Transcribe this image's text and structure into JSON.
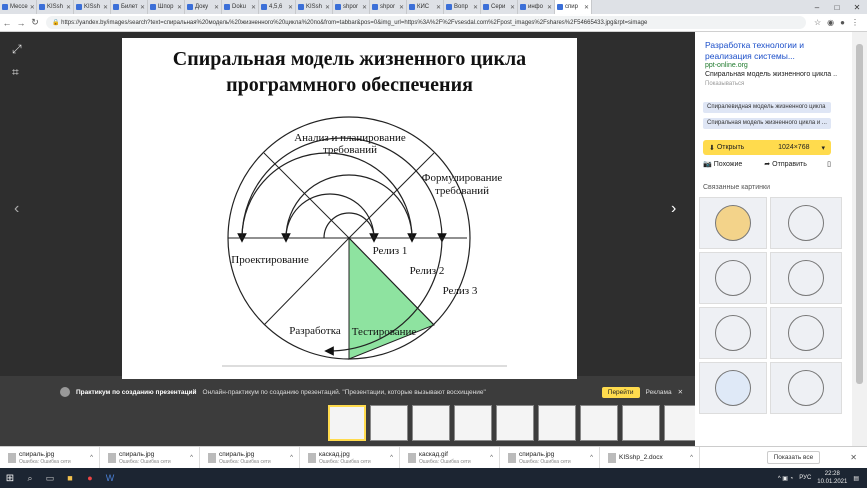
{
  "tabs": [
    {
      "label": "Мессе"
    },
    {
      "label": "KISsh"
    },
    {
      "label": "KISsh"
    },
    {
      "label": "Билет"
    },
    {
      "label": "Шпор"
    },
    {
      "label": "Доку"
    },
    {
      "label": "Doku"
    },
    {
      "label": "4,5,6"
    },
    {
      "label": "KISsh"
    },
    {
      "label": "shpor"
    },
    {
      "label": "shpor"
    },
    {
      "label": "КИС"
    },
    {
      "label": "Вопр"
    },
    {
      "label": "Сери"
    },
    {
      "label": "инфо"
    },
    {
      "label": "спир"
    }
  ],
  "address": {
    "url": "https://yandex.by/images/search?text=спиральная%20модель%20жизненного%20цикла%20по&from=tabbar&pos=0&img_url=https%3A%2F%2Fvsesdal.com%2Fpost_images%2Fshares%2F54665433.jpg&rpt=simage"
  },
  "slide": {
    "title_line1": "Спиральная модель жизненного цикла",
    "title_line2": "программного обеспечения",
    "labels": {
      "analysis": "Анализ и планирование",
      "analysis2": "требований",
      "formulation": "Формулирование",
      "formulation2": "требований",
      "design": "Проектирование",
      "development": "Разработка",
      "testing": "Тестирование",
      "release1": "Релиз 1",
      "release2": "Релиз 2",
      "release3": "Релиз 3"
    }
  },
  "right_panel": {
    "title": "Разработка технологии и реализация системы...",
    "site": "ppt-online.org",
    "desc": "Спиральная модель жизненного цикла ...",
    "ad": "Показываться",
    "chip1": "Спиралевидная модель жизненного цикла",
    "chip2": "Спиральная модель жизненного цикла и ...",
    "open_label": "Открыть",
    "size": "1024×768",
    "similar": "Похожие",
    "send": "Отправить",
    "related": "Связанные картинки"
  },
  "promo": {
    "title": "Практикум по созданию презентаций",
    "text": "Онлайн-практикум по созданию презентаций. \"Презентации, которые вызывают восхищение\"",
    "go": "Перейти",
    "ad": "Реклама"
  },
  "downloads": [
    {
      "name": "спираль.jpg",
      "error": "Ошибка: Ошибка сети"
    },
    {
      "name": "спираль.jpg",
      "error": "Ошибка: Ошибка сети"
    },
    {
      "name": "спираль.jpg",
      "error": "Ошибка: Ошибка сети"
    },
    {
      "name": "каскад.jpg",
      "error": "Ошибка: Ошибка сети"
    },
    {
      "name": "каскад.gif",
      "error": "Ошибка: Ошибка сети"
    },
    {
      "name": "спираль.jpg",
      "error": "Ошибка: Ошибка сети"
    },
    {
      "name": "KISshp_2.docx",
      "error": ""
    }
  ],
  "show_all": "Показать все",
  "tray": {
    "lang": "РУС",
    "time": "22:28",
    "date": "10.01.2021"
  }
}
